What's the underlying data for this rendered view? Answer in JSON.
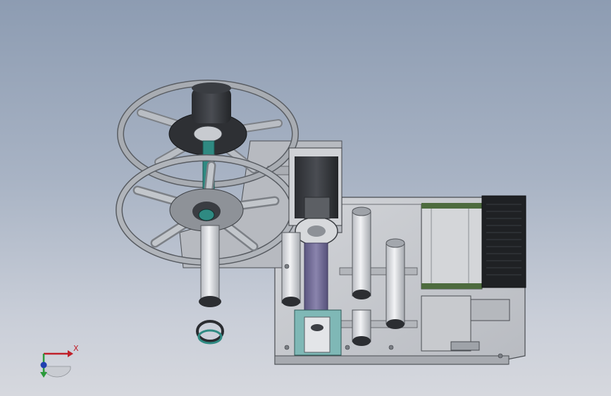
{
  "viewport": {
    "background_top": "#8d9cb2",
    "background_bottom": "#d6d8de"
  },
  "axis_triad": {
    "x_label": "X",
    "x_color": "#c0202a",
    "y_color": "#2a9a3a",
    "z_color": "#2040b0"
  },
  "model": {
    "frame_color": "#c9ccd2",
    "reel_color": "#9ea3ab",
    "motor_color": "#3a3d42",
    "shaft_accent": "#2f8a82",
    "roller_color": "#e1e3e6",
    "purple_roller": "#6f6a93",
    "teal_bracket": "#7fb8b6"
  }
}
